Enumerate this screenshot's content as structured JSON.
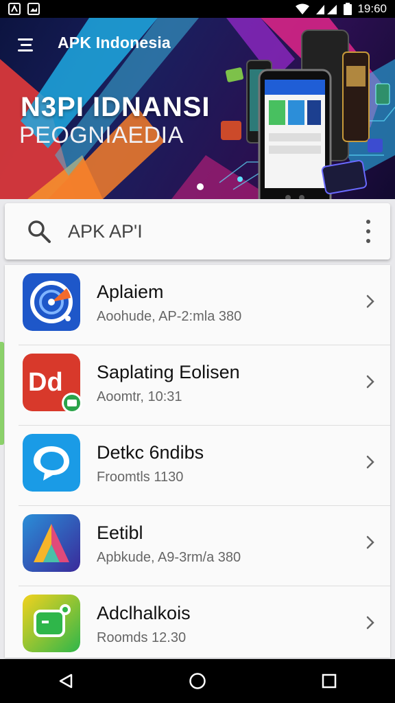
{
  "status_bar": {
    "time": "19:60",
    "icons": [
      "app-notification-icon",
      "image-notification-icon",
      "wifi-icon",
      "signal-icon",
      "battery-icon"
    ]
  },
  "banner": {
    "app_title": "APK Indonesia",
    "headline": "N3PI IDNANSI",
    "subline": "PEOGNIAEDIA",
    "colors": {
      "accent_cyan": "#1fa9e1",
      "accent_magenta": "#e0268a",
      "accent_orange": "#f2762e"
    }
  },
  "search": {
    "query": "APK AP'I",
    "icon": "search-icon",
    "menu_icon": "more-vert-icon"
  },
  "apps": [
    {
      "title": "Aplaiem",
      "subtitle": "Aoohude, AP-2:mla 380",
      "icon": "radar-target-icon",
      "color": "#1e57c9"
    },
    {
      "title": "Saplating Eolisen",
      "subtitle": "Aoomtr, 10:31",
      "icon": "dd-logo-icon",
      "color": "#d8392b"
    },
    {
      "title": "Detkc 6ndibs",
      "subtitle": "Froomtls 1130",
      "icon": "chat-bubble-icon",
      "color": "#1a9be6"
    },
    {
      "title": "Eetibl",
      "subtitle": "Apbkude, A9-3rm/a 380",
      "icon": "triangle-logo-icon",
      "color": "#2e3ea8"
    },
    {
      "title": "Adclhalkois",
      "subtitle": "Roomds 12.30",
      "icon": "green-message-icon",
      "color": "#35b84a"
    }
  ],
  "nav": {
    "back": "back-icon",
    "home": "home-icon",
    "recents": "recents-icon"
  }
}
